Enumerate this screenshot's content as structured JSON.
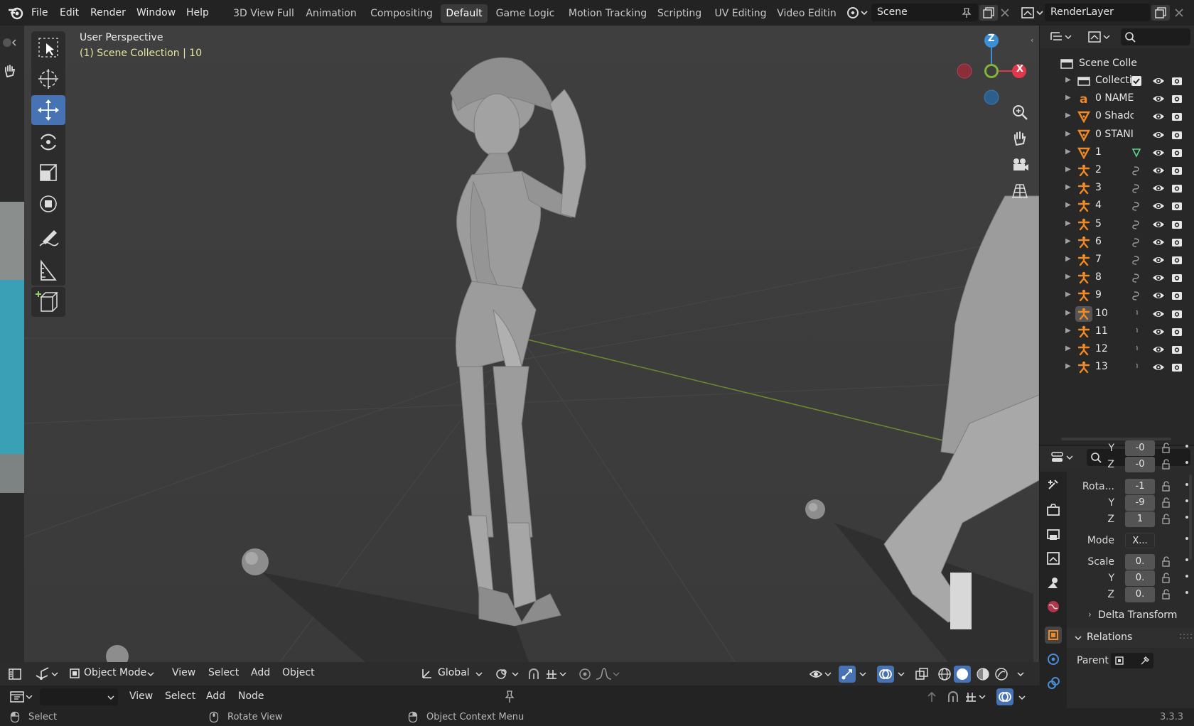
{
  "topbar": {
    "menus": [
      "File",
      "Edit",
      "Render",
      "Window",
      "Help"
    ],
    "workspaces": [
      "3D View Full",
      "Animation",
      "Compositing",
      "Default",
      "Game Logic",
      "Motion Tracking",
      "Scripting",
      "UV Editing",
      "Video Editin"
    ],
    "active_workspace": "Default",
    "scene_name": "Scene",
    "render_layer": "RenderLayer"
  },
  "viewport": {
    "view_name": "User Perspective",
    "collection_info": "(1) Scene Collection | 10",
    "gizmo_axes": {
      "z": "Z",
      "x": "X"
    },
    "colors": {
      "background": "#3d3d3d",
      "active_tool": "#4772b3",
      "info_text": "#e6e6a0",
      "x_axis": "#e0384b",
      "y_axis": "#82b33a",
      "z_axis": "#3b8fd6"
    }
  },
  "viewport_header": {
    "mode": "Object Mode",
    "menus": [
      "View",
      "Select",
      "Add",
      "Object"
    ],
    "orientation": "Global"
  },
  "editor_header2": {
    "menus": [
      "View",
      "Select",
      "Add",
      "Node"
    ]
  },
  "outliner": {
    "root": "Scene Colle",
    "items": [
      {
        "label": "Collectic",
        "icon": "collection-icon"
      },
      {
        "label": "0 NAME",
        "icon": "text-object-icon"
      },
      {
        "label": "0 Shadc",
        "icon": "mesh-icon"
      },
      {
        "label": "0 STANI",
        "icon": "mesh-icon"
      },
      {
        "label": "1",
        "icon": "mesh-icon"
      },
      {
        "label": "2",
        "icon": "armature-icon"
      },
      {
        "label": "3",
        "icon": "armature-icon"
      },
      {
        "label": "4",
        "icon": "armature-icon"
      },
      {
        "label": "5",
        "icon": "armature-icon"
      },
      {
        "label": "6",
        "icon": "armature-icon"
      },
      {
        "label": "7",
        "icon": "armature-icon"
      },
      {
        "label": "8",
        "icon": "armature-icon"
      },
      {
        "label": "9",
        "icon": "armature-icon"
      },
      {
        "label": "10",
        "icon": "armature-icon"
      },
      {
        "label": "11",
        "icon": "armature-icon"
      },
      {
        "label": "12",
        "icon": "armature-icon"
      },
      {
        "label": "13",
        "icon": "armature-icon"
      }
    ]
  },
  "properties": {
    "location": {
      "y": "-0",
      "z": "-0"
    },
    "rotation": {
      "label": "Rota...",
      "x": "-1",
      "y": "-9",
      "z": "1"
    },
    "mode": {
      "label": "Mode",
      "value": "X..."
    },
    "scale": {
      "label": "Scale",
      "x": "0.",
      "y": "0.",
      "z": "0."
    },
    "axis_labels": {
      "y": "Y",
      "z": "Z"
    },
    "delta_transform": "Delta Transform",
    "relations": "Relations",
    "parent_label": "Parent"
  },
  "statusbar": {
    "select": "Select",
    "rotate_view": "Rotate View",
    "context_menu": "Object Context Menu",
    "version": "3.3.3"
  }
}
